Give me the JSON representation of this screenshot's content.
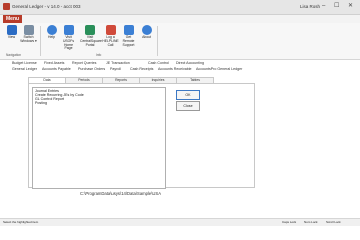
{
  "window": {
    "title": "General Ledger  -  v 14.0  -  acct 003",
    "user": "Lisa Rosh",
    "controls": [
      "–",
      "☐",
      "✕"
    ]
  },
  "menu": {
    "active_tab": "Menu"
  },
  "ribbon": {
    "buttons": [
      {
        "label": "View",
        "icon": "view-icon",
        "color": "#2b6cc4"
      },
      {
        "label": "Switch Windows ▾",
        "icon": "switch-windows-icon",
        "color": "#7a8ea3"
      },
      {
        "label": "Help",
        "icon": "help-icon",
        "color": "#3b7fd4"
      },
      {
        "label": "Visit USOFs Home Page",
        "icon": "home-page-icon",
        "color": "#3b7fd4"
      },
      {
        "label": "Visit CentralSquare Portal",
        "icon": "portal-icon",
        "color": "#2a8f5a"
      },
      {
        "label": "Log a HELPLINE Call",
        "icon": "helpline-icon",
        "color": "#d04a3a"
      },
      {
        "label": "Get Remote Support",
        "icon": "remote-support-icon",
        "color": "#3b7fd4"
      },
      {
        "label": "About",
        "icon": "about-icon",
        "color": "#3b7fd4"
      }
    ],
    "groups": [
      "Navigation",
      "Info"
    ]
  },
  "nav_tabs": {
    "row1": [
      "Budget License",
      "Fixed Assets",
      "Report Queries",
      "JE Transaction",
      "Cash Control",
      "Direct Accounting"
    ],
    "row2": [
      "General Ledger",
      "Accounts Payable",
      "Purchase Orders",
      "Payroll",
      "Cash Receipts",
      "Accounts Receivable",
      "AccountsPro General Ledger"
    ]
  },
  "dialog": {
    "tabs": [
      "Data",
      "Periods",
      "Reports",
      "Inquiries",
      "Tables"
    ],
    "list_items": [
      "Journal Entries",
      "Create Recurring JEs by Code",
      "GL Control Report",
      "Posting"
    ],
    "ok_label": "OK",
    "close_label": "Close",
    "path": "C:\\ProgramData\\usys\\14\\Data\\Sample\\USA"
  },
  "status": {
    "left": "Select the highlighted item",
    "right": [
      "Caps Lock",
      "Num Lock",
      "Scroll Lock"
    ]
  }
}
